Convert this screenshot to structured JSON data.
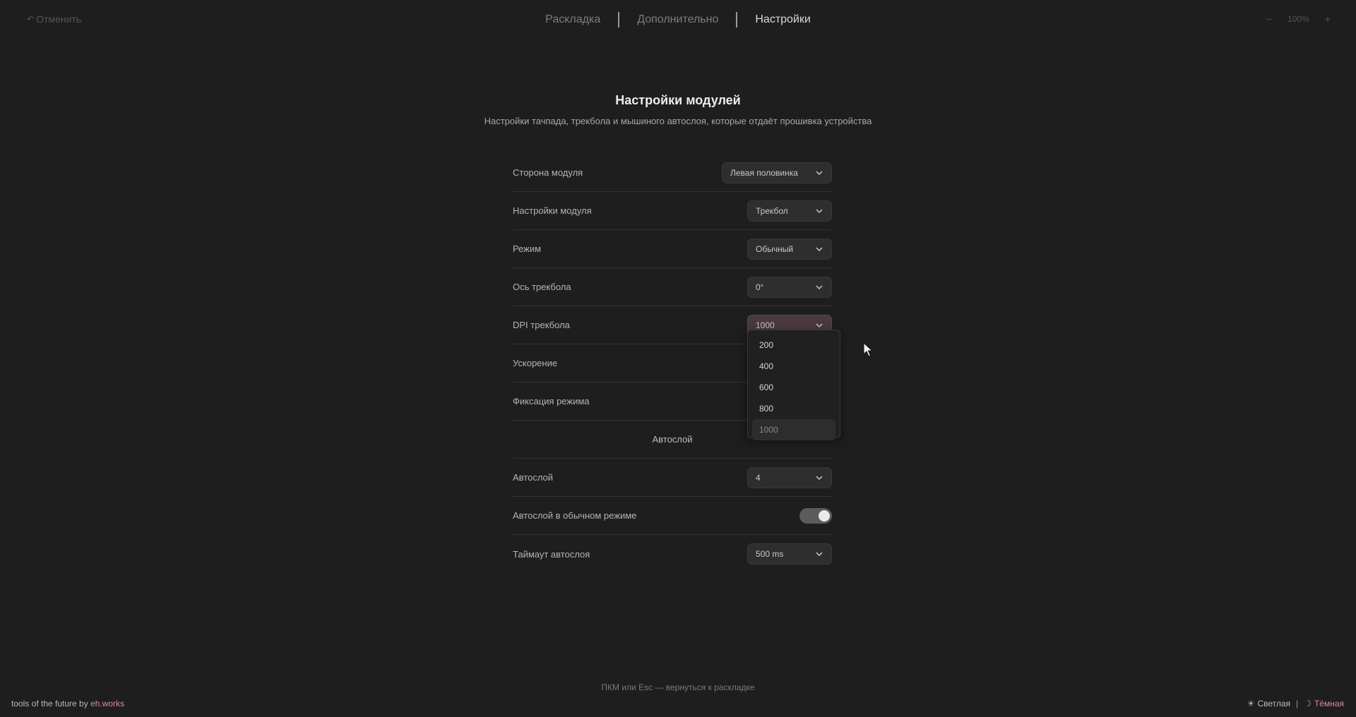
{
  "topbar": {
    "undo_icon": "undo-icon",
    "undo_label": "Отменить",
    "tabs": [
      {
        "label": "Раскладка",
        "active": false
      },
      {
        "label": "Дополнительно",
        "active": false
      },
      {
        "label": "Настройки",
        "active": true
      }
    ],
    "zoom": {
      "minus": "−",
      "level": "100%",
      "plus": "+"
    }
  },
  "header": {
    "title": "Настройки модулей",
    "subtitle": "Настройки тачпада, трекбола и мышиного автослоя, которые отдаёт прошивка устройства"
  },
  "settings": {
    "module_side": {
      "label": "Сторона модуля",
      "value": "Левая половинка"
    },
    "module_settings": {
      "label": "Настройки модуля",
      "value": "Трекбол"
    },
    "mode": {
      "label": "Режим",
      "value": "Обычный"
    },
    "trackball_axis": {
      "label": "Ось трекбола",
      "value": "0°"
    },
    "trackball_dpi": {
      "label": "DPI трекбола",
      "value": "1000"
    },
    "acceleration": {
      "label": "Ускорение"
    },
    "mode_lock": {
      "label": "Фиксация режима"
    },
    "autolayer_section": {
      "label": "Автослой"
    },
    "autolayer": {
      "label": "Автослой",
      "value": "4"
    },
    "autolayer_normal": {
      "label": "Автослой в обычном режиме",
      "enabled": true
    },
    "autolayer_timeout": {
      "label": "Таймаут автослоя",
      "value": "500 ms"
    }
  },
  "dpi_dropdown": {
    "options": [
      "200",
      "400",
      "600",
      "800",
      "1000"
    ],
    "selected": "1000"
  },
  "footer": {
    "hint": "ПКМ или Esc — вернуться к раскладке",
    "credit_prefix": "tools of the future by ",
    "credit_link": "eh.works",
    "theme_light": "Светлая",
    "theme_dark": "Тёмная",
    "theme_separator": "|",
    "light_icon": "sun-icon",
    "dark_icon": "moon-icon",
    "active_theme": "dark"
  },
  "colors": {
    "background": "#1e1e1e",
    "accent": "#e08a9c",
    "select_open": "#4a3a3d"
  }
}
